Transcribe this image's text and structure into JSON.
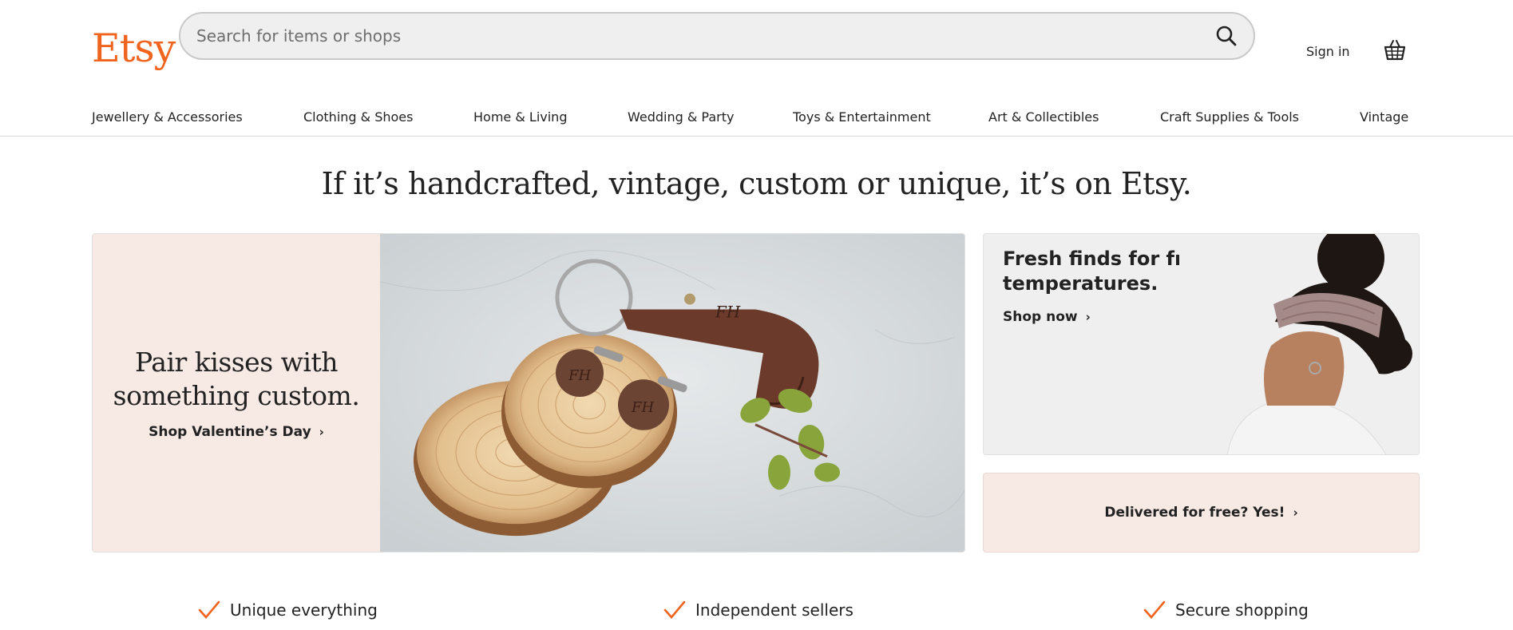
{
  "header": {
    "logo": "Etsy",
    "search_placeholder": "Search for items or shops",
    "sign_in": "Sign in"
  },
  "nav": {
    "items": [
      "Jewellery & Accessories",
      "Clothing & Shoes",
      "Home & Living",
      "Wedding & Party",
      "Toys & Entertainment",
      "Art & Collectibles",
      "Craft Supplies & Tools",
      "Vintage"
    ]
  },
  "tagline": "If it’s handcrafted, vintage, custom or unique, it’s on Etsy.",
  "hero": {
    "title_line1": "Pair kisses with",
    "title_line2": "something custom.",
    "link": "Shop Valentine’s Day",
    "bg_color": "#f7e9e4"
  },
  "promo_top": {
    "title": "Fresh finds for frosty temperatures.",
    "link": "Shop now"
  },
  "promo_bottom": {
    "label": "Delivered for free? Yes!"
  },
  "features": [
    {
      "title": "Unique everything",
      "icon": "checkmark-icon"
    },
    {
      "title": "Independent sellers",
      "icon": "checkmark-icon"
    },
    {
      "title": "Secure shopping",
      "icon": "checkmark-icon"
    }
  ],
  "colors": {
    "brand": "#f1641e",
    "text": "#222222",
    "pink": "#f7e9e4"
  }
}
